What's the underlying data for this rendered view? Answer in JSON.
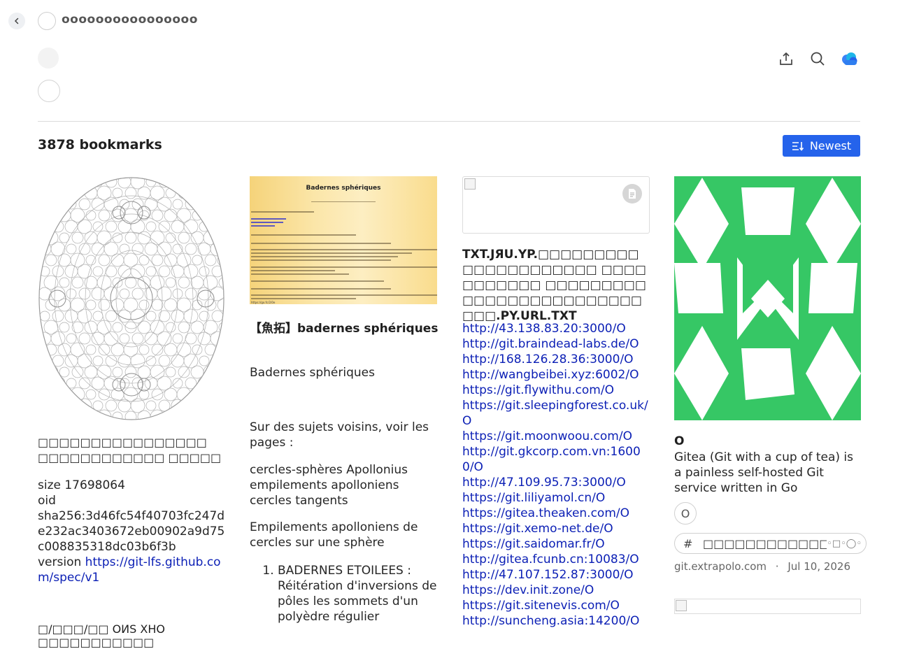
{
  "header": {
    "user_name": "oooooooooooooooo"
  },
  "toolbar": {
    "icons": [
      "share-icon",
      "search-icon",
      "cloud-icon"
    ]
  },
  "list": {
    "count_title": "3878 bookmarks",
    "sort_label": "Newest"
  },
  "cards": {
    "c1": {
      "title": "□□□□□□□□□□□□□□□□ □□□□□□□□□□□□ □□□□□",
      "size_label": "size 17698064",
      "oid_label": "oid",
      "oid_value": "sha256:3d46fc54f40703fc247de232ac3403672eb00902a9d75c008835318dc03b6f3b",
      "version_label": "version ",
      "version_link": "https://git-lfs.github.com/spec/v1",
      "foot_text": "□/□□□/□□ OИS XHO □□□□□□□□□□□"
    },
    "c2": {
      "image_title": "Badernes sphériques",
      "image_caption": "https://go.fc/2/0e",
      "title": "【魚拓】badernes sphériques",
      "subtitle": "Badernes sphériques",
      "p1": "Sur des sujets voisins, voir les pages :",
      "p2": "cercles-sphères Apollonius empilements apolloniens cercles tangents",
      "p3": "Empilements apolloniens de cercles sur une sphère",
      "list_item": "BADERNES ETOILEES : Réitération d'inversions de pôles les sommets d'un polyèdre régulier"
    },
    "c3": {
      "title": "TXT.JЯU.YP.□□□□□□□□□□□□□□□□□□□□□ □□□□□□□□□□□ □□□□□□□□□□□□□□□□□□□□□□□□□□□□.PY.URL.TXT",
      "links": [
        "http://43.138.83.20:3000/O",
        "http://git.braindead-labs.de/O",
        "http://168.126.28.36:3000/O",
        "http://wangbeibei.xyz:6002/O",
        "https://git.flywithu.com/O",
        "https://git.sleepingforest.co.uk/O",
        "https://git.moonwoou.com/O",
        "http://git.gkcorp.com.vn:16000/O",
        "http://47.109.95.73:3000/O",
        "https://git.liliyamol.cn/O",
        "https://gitea.theaken.com/O",
        "https://git.xemo-net.de/O",
        "https://git.saidomar.fr/O",
        "http://gitea.fcunb.cn:10083/O",
        "http://47.107.152.87:3000/O",
        "https://dev.init.zone/O",
        "https://git.sitenevis.com/O",
        "http://suncheng.asia:14200/O"
      ]
    },
    "c4": {
      "title": "O",
      "description": "Gitea (Git with a cup of tea) is a painless self-hosted Git service written in Go",
      "tag": "O",
      "tag_input_hash": "#",
      "tag_input_placeholder": "□□□□□□□□□□□□□□□□□□□□",
      "tag_input_dots": "◦□◦◯◦",
      "source": "git.extrapolo.com",
      "separator": "·",
      "date": "Jul 10, 2026",
      "image_color": "#36c765"
    }
  },
  "colors": {
    "accent": "#2563eb",
    "link": "#0b1fb5"
  }
}
